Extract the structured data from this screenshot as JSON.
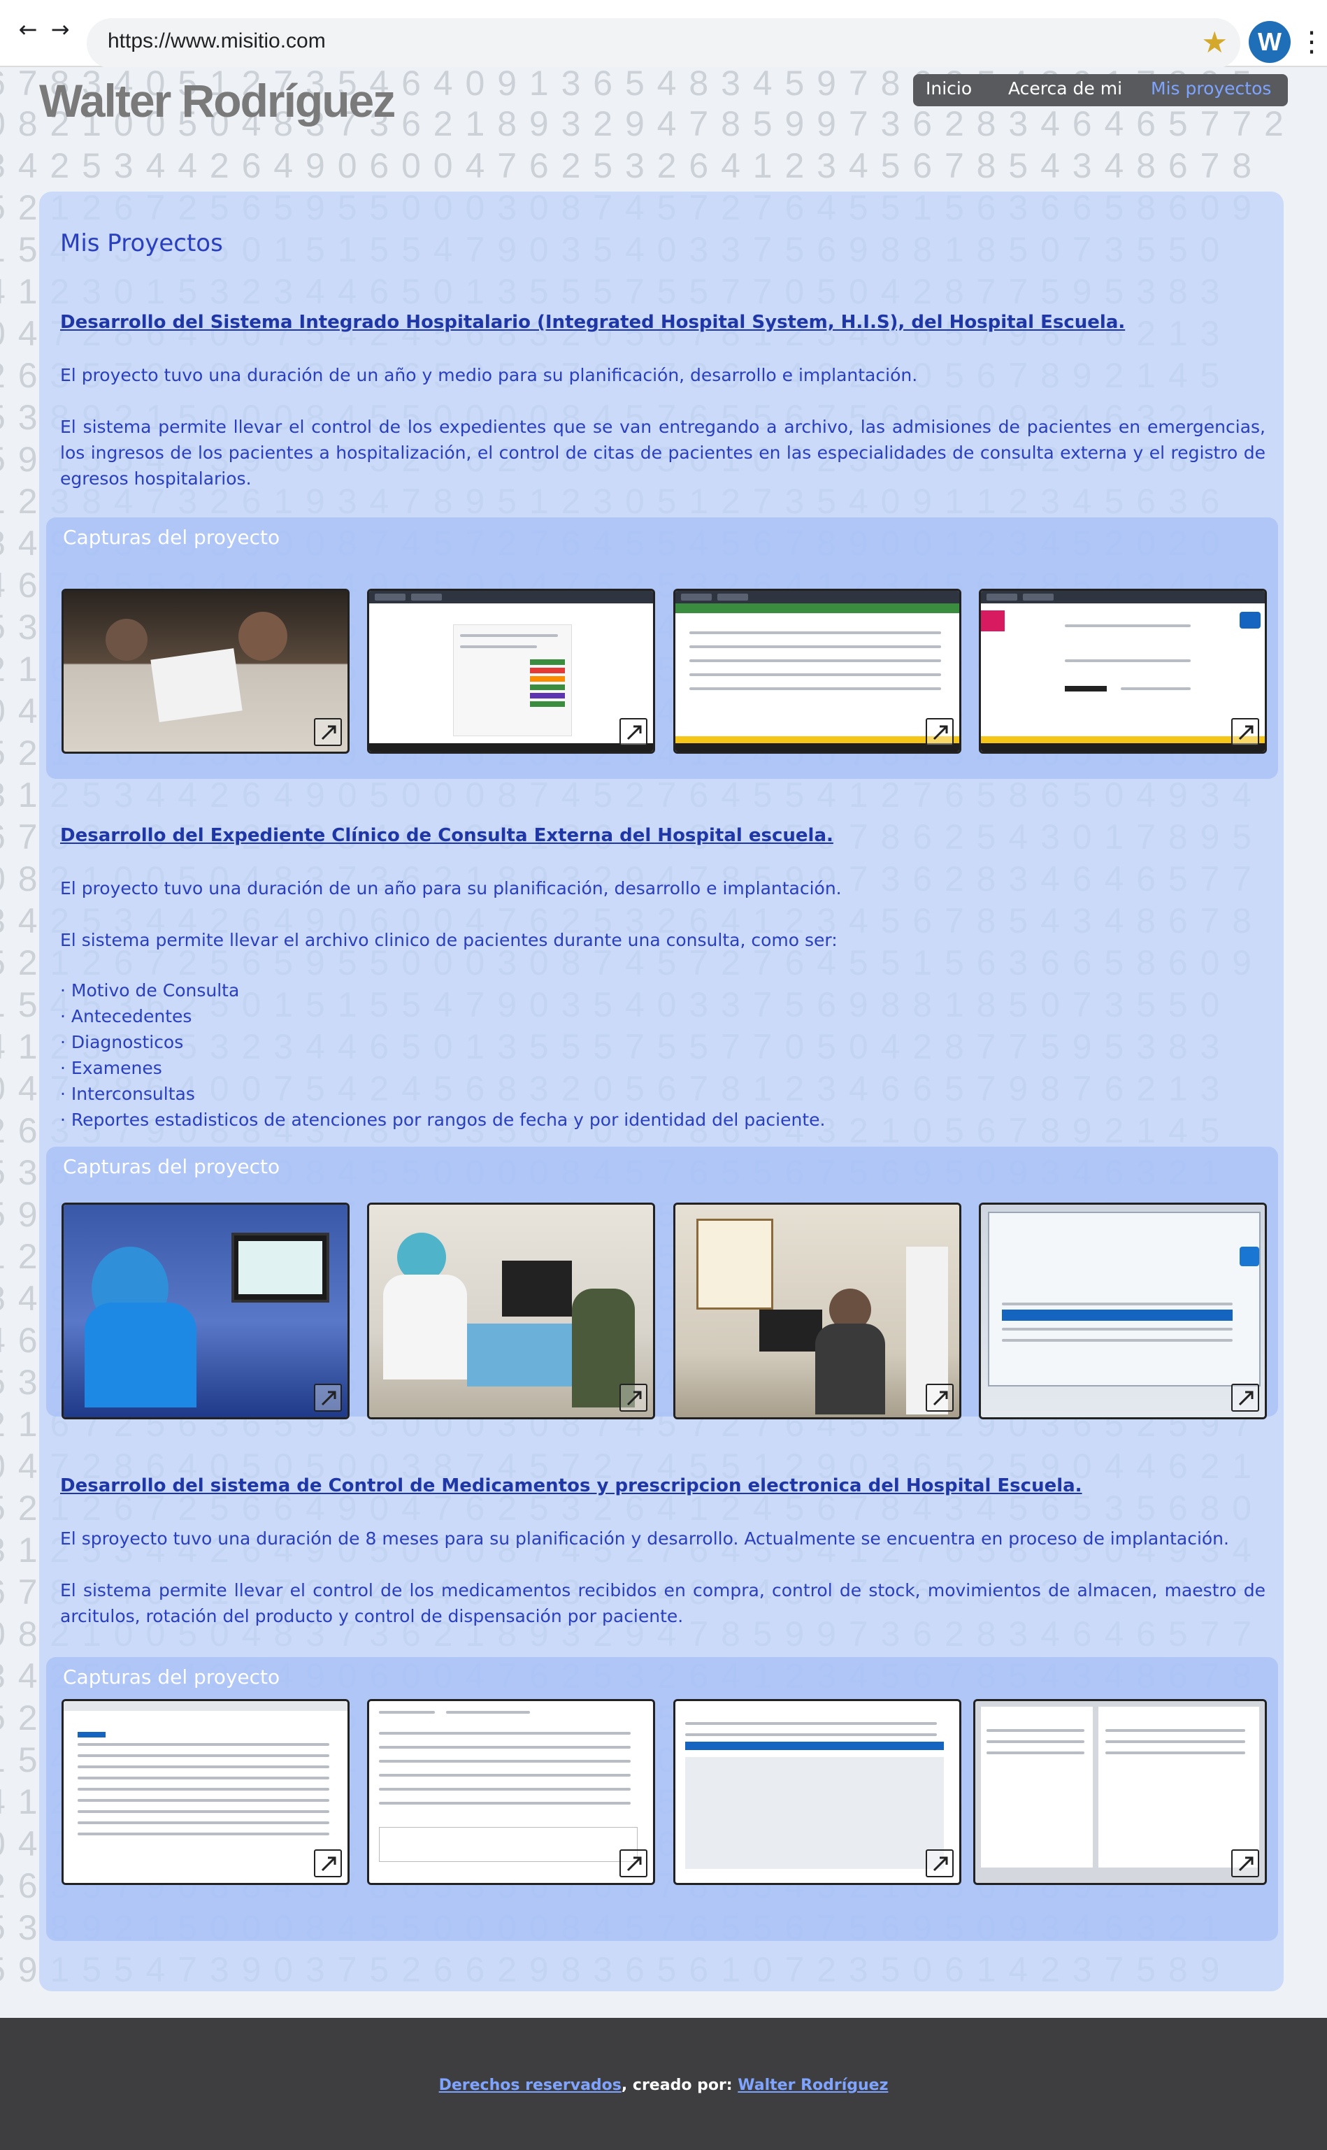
{
  "browser": {
    "url": "https://www.misitio.com",
    "back_icon": "arrow-left-icon",
    "forward_icon": "arrow-right-icon",
    "bookmark_icon": "star-icon",
    "profile_initial": "W",
    "menu_icon": "kebab-menu-icon"
  },
  "site": {
    "title": "Walter Rodríguez"
  },
  "nav": {
    "items": [
      {
        "label": "Inicio"
      },
      {
        "label": "Acerca de mi"
      },
      {
        "label": "Mis proyectos"
      }
    ],
    "active": "Mis proyectos"
  },
  "main": {
    "heading": "Mis Proyectos",
    "gallery_label": "Capturas del proyecto",
    "projects": [
      {
        "title": "Desarrollo del Sistema Integrado Hospitalario (Integrated Hospital System, H.I.S), del Hospital Escuela.",
        "paragraphs": [
          "El proyecto tuvo una duración de un año y medio para su planificación, desarrollo e implantación.",
          "El sistema permite llevar el control de los expedientes que se van entregando a archivo, las admisiones de pacientes en emergencias, los ingresos de los pacientes a hospitalización, el control de citas de pacientes en las especialidades de consulta externa y el registro de egresos hospitalarios."
        ]
      },
      {
        "title": "Desarrollo del Expediente Clínico de Consulta Externa del Hospital escuela.",
        "paragraphs": [
          "El proyecto tuvo una duración de un  año para su planificación, desarrollo e implantación.",
          "El sistema permite llevar el archivo clinico de pacientes durante una consulta, como ser:"
        ],
        "bullets": [
          "· Motivo de Consulta",
          "· Antecedentes",
          "· Diagnosticos",
          "· Examenes",
          "· Interconsultas",
          "· Reportes estadisticos de atenciones por rangos de fecha y por identidad del paciente."
        ]
      },
      {
        "title": "Desarrollo del sistema de Control de Medicamentos y prescripcion electronica del Hospital Escuela.",
        "paragraphs": [
          "El sproyecto tuvo una duración de 8 meses para su planificación y desarrollo. Actualmente se encuentra en proceso de implantación.",
          "El sistema permite llevar el control de los medicamentos recibidos en compra, control de stock, movimientos de almacen, maestro de arcitulos, rotación del producto y control de dispensación por paciente."
        ]
      }
    ]
  },
  "footer": {
    "rights_text": "Derechos reservados",
    "created_by_text": ", creado por: ",
    "author_link": "Walter Rodríguez"
  },
  "colors": {
    "panel": "#c0d4f8",
    "gallery": "#a8c0f6",
    "text": "#2a3fbf",
    "nav_bg": "#585a5e",
    "nav_active": "#7ea4ff",
    "footer_bg": "#3e3e40"
  }
}
